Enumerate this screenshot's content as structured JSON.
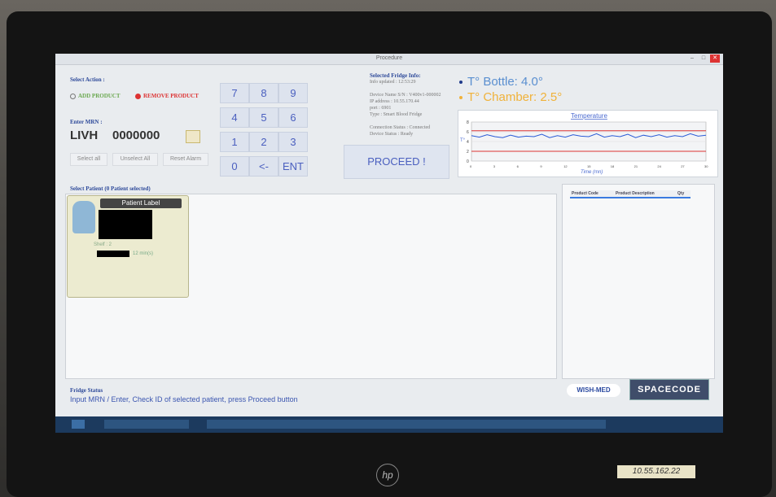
{
  "window": {
    "title": "Procedure"
  },
  "action": {
    "label": "Select Action :",
    "add_label": "ADD PRODUCT",
    "remove_label": "REMOVE PRODUCT",
    "selected": "REMOVE PRODUCT"
  },
  "mrn": {
    "label": "Enter MRN :",
    "prefix": "LIVH",
    "value": "0000000"
  },
  "buttons": {
    "select_all": "Select all",
    "unselect_all": "Unselect All",
    "reset_alarm": "Reset Alarm"
  },
  "keypad": [
    "7",
    "8",
    "9",
    "4",
    "5",
    "6",
    "1",
    "2",
    "3",
    "0",
    "<-",
    "ENT"
  ],
  "fridge_info": {
    "title": "Selected Fridge Info:",
    "updated": "Info updated : 12:53:29",
    "device_name": "Device Name S/N : V400v1-000002",
    "ip": "IP address : 10.55.170.44",
    "port": "port : 6901",
    "type": "Type : Smart Blood Fridge",
    "connection": "Connection Status : Connected",
    "device_status": "Device Status : Ready"
  },
  "proceed_label": "PROCEED !",
  "temperatures": {
    "bottle": "T° Bottle: 4.0°",
    "chamber": "T° Chamber: 2.5°",
    "bottle_color": "#1f3a8a",
    "chamber_color": "#f0b23a"
  },
  "chart_data": {
    "type": "line",
    "title": "Temperature",
    "xlabel": "Time (mn)",
    "ylabel": "T°",
    "ylim": [
      0,
      8
    ],
    "x": [
      0,
      1,
      2,
      3,
      4,
      5,
      6,
      7,
      8,
      9,
      10,
      11,
      12,
      13,
      14,
      15,
      16,
      17,
      18,
      19,
      20,
      21,
      22,
      23,
      24,
      25,
      26,
      27,
      28,
      29,
      30
    ],
    "series": [
      {
        "values": [
          5.2,
          4.9,
          5.4,
          5.0,
          4.8,
          5.3,
          4.9,
          5.1,
          5.0,
          5.5,
          4.8,
          5.2,
          4.9,
          5.4,
          5.1,
          5.0,
          5.6,
          4.9,
          5.2,
          5.0,
          5.5,
          4.8,
          5.3,
          5.0,
          5.4,
          4.9,
          5.2,
          5.0,
          5.6,
          5.1,
          5.3
        ],
        "color": "#2a5bd7"
      },
      {
        "values": [
          6.2,
          6.2,
          6.2,
          6.2,
          6.2,
          6.2,
          6.2,
          6.2,
          6.2,
          6.2,
          6.2,
          6.2,
          6.2,
          6.2,
          6.2,
          6.2,
          6.2,
          6.2,
          6.2,
          6.2,
          6.2,
          6.2,
          6.2,
          6.2,
          6.2,
          6.2,
          6.2,
          6.2,
          6.2,
          6.2,
          6.2
        ],
        "color": "#d33"
      },
      {
        "values": [
          2.0,
          2.0,
          2.0,
          2.0,
          2.0,
          2.0,
          2.0,
          2.0,
          2.0,
          2.0,
          2.0,
          2.0,
          2.0,
          2.0,
          2.0,
          2.0,
          2.0,
          2.0,
          2.0,
          2.0,
          2.0,
          2.0,
          2.0,
          2.0,
          2.0,
          2.0,
          2.0,
          2.0,
          2.0,
          2.0,
          2.0
        ],
        "color": "#d33"
      }
    ]
  },
  "patients": {
    "header": "Select Patient (0 Patient selected)",
    "card_title": "Patient Label",
    "shelf": "Shelf : 2",
    "time": "12 min(s)"
  },
  "products": {
    "headers": [
      "Product Code",
      "Product Description",
      "Qty"
    ],
    "rows": [
      [
        "",
        "",
        ""
      ],
      [
        "",
        "",
        ""
      ]
    ]
  },
  "status": {
    "title": "Fridge Status",
    "message": "Input MRN / Enter, Check ID of selected patient, press Proceed button"
  },
  "logos": {
    "wishmed": "WISH-MED",
    "spacecode": "SPACECODE"
  },
  "monitor": {
    "brand": "hp",
    "sticker": "10.55.162.22"
  }
}
